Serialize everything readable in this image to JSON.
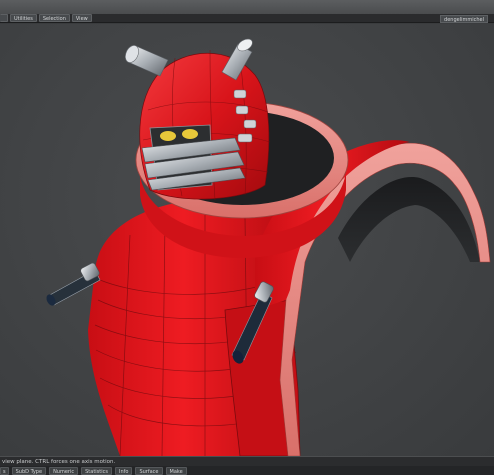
{
  "menu": {
    "tabs": [
      "",
      "Utilities",
      "Selection",
      "View"
    ],
    "scene_name": "dengelimmichel"
  },
  "status": {
    "text": "view plane. CTRL forces one axis motion."
  },
  "toolbar": {
    "items": [
      "s",
      "SubD Type",
      "Numeric",
      "Statistics",
      "Info",
      "Surface",
      "Make"
    ]
  },
  "colors": {
    "model_red": "#e0141a",
    "trim_pink": "#e8847e",
    "viewport_bg": "#414345",
    "ui_dark": "#2a2b2d"
  }
}
